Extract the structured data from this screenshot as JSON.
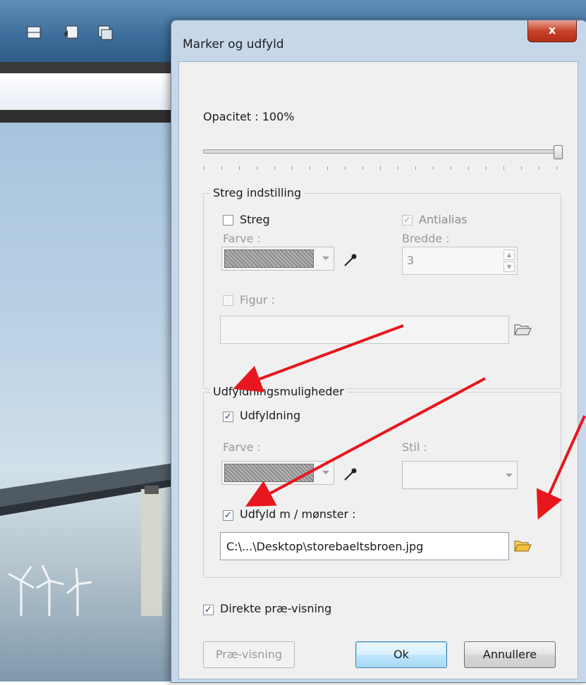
{
  "dialog": {
    "title": "Marker og udfyld",
    "close_label": "x"
  },
  "opacity": {
    "label": "Opacitet : 100%",
    "value_percent": 100
  },
  "stroke_group": {
    "title": "Streg indstilling",
    "stroke_checkbox": {
      "label": "Streg",
      "checked": false
    },
    "antialias_checkbox": {
      "label": "Antialias",
      "checked": true,
      "disabled": true
    },
    "color_label": "Farve :",
    "width_label": "Bredde :",
    "width_value": "3",
    "figure_checkbox": {
      "label": "Figur :",
      "checked": false,
      "disabled": true
    },
    "figure_path": ""
  },
  "fill_group": {
    "title": "Udfyldningsmuligheder",
    "fill_checkbox": {
      "label": "Udfyldning",
      "checked": true
    },
    "color_label": "Farve :",
    "style_label": "Stil :",
    "style_value": "",
    "pattern_checkbox": {
      "label": "Udfyld m / mønster :",
      "checked": true
    },
    "pattern_path": "C:\\...\\Desktop\\storebaeltsbroen.jpg"
  },
  "live_preview_checkbox": {
    "label": "Direkte præ-visning",
    "checked": true
  },
  "buttons": {
    "preview": "Præ-visning",
    "ok": "Ok",
    "cancel": "Annullere"
  },
  "colors": {
    "annotation_arrow": "#e8161d",
    "dialog_frame": "#c6d7ea",
    "close_button": "#c7432a"
  },
  "check_mark": "✓"
}
